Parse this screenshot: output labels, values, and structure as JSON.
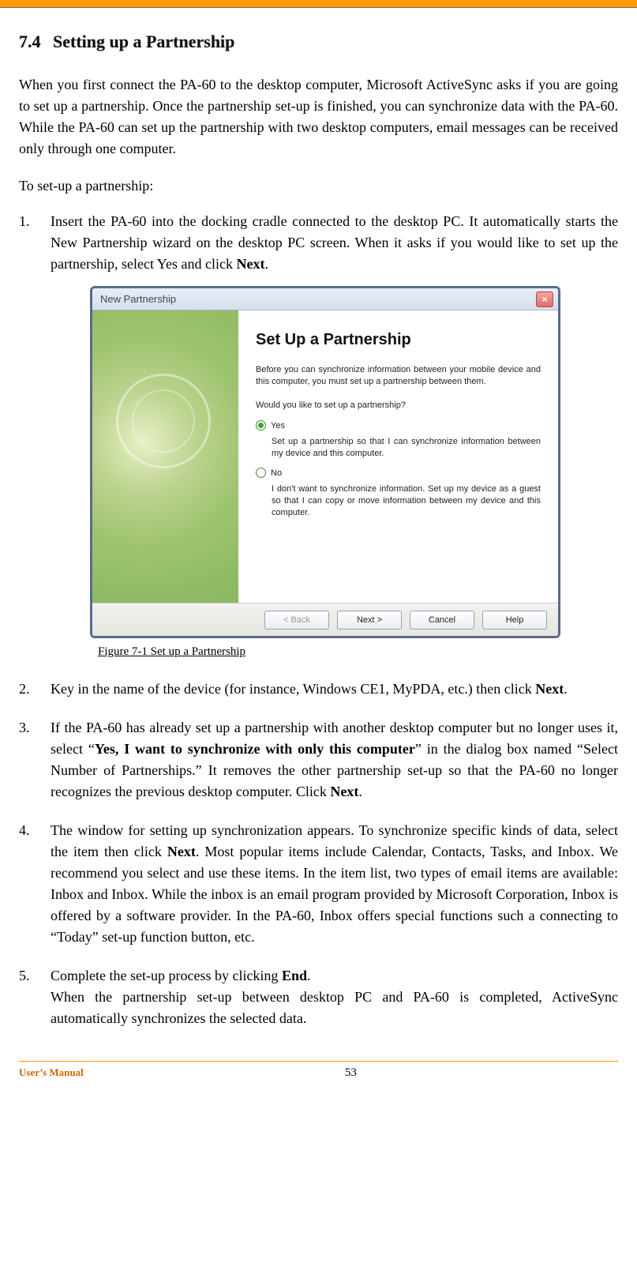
{
  "section": {
    "number": "7.4",
    "title": "Setting up a Partnership"
  },
  "intro": "When you first connect the PA-60 to the desktop computer, Microsoft ActiveSync asks if you are going to set up a partnership. Once the partnership set-up is finished, you can synchronize data with the PA-60. While the PA-60 can set up the partnership with two desktop computers, email messages can be received only through one computer.",
  "lead": "To set-up a partnership:",
  "steps": {
    "s1_a": "Insert the PA-60 into the docking cradle connected to the desktop PC. It automatically starts the New Partnership wizard on the desktop PC screen. When it asks if you would like to set up the partnership, select Yes and click ",
    "s1_bold": "Next",
    "s1_b": ".",
    "s2_a": "Key in the name of the device (for instance, Windows CE1, MyPDA, etc.) then click ",
    "s2_bold": "Next",
    "s2_b": ".",
    "s3_a": "If the PA-60 has already set up a partnership with another desktop computer but no longer uses it, select “",
    "s3_bold1": "Yes, I want to synchronize with only this computer",
    "s3_b": "” in the dialog box named “Select Number of Partnerships.” It removes the other partnership set-up so that the PA-60 no longer recognizes the previous desktop computer. Click ",
    "s3_bold2": "Next",
    "s3_c": ".",
    "s4_a": "The window for setting up synchronization appears. To synchronize specific kinds of data, select the item then click ",
    "s4_bold": "Next",
    "s4_b": ". Most popular items include Calendar, Contacts, Tasks, and Inbox. We recommend you select and use these items. In the item list, two types of email items are available: Inbox and Inbox. While the inbox is an email program provided by Microsoft Corporation, Inbox is offered by a software provider. In the PA-60, Inbox offers special functions such a connecting to “Today” set-up function button, etc.",
    "s5_a": "Complete the set-up process by clicking ",
    "s5_bold": "End",
    "s5_b": ".",
    "s5_c": "When the partnership set-up between desktop PC and PA-60 is completed, ActiveSync automatically synchronizes the selected data."
  },
  "dialog": {
    "window_title": "New Partnership",
    "heading": "Set Up a Partnership",
    "desc": "Before you can synchronize information between your mobile device and this computer, you must set up a partnership between them.",
    "question": "Would you like to set up a partnership?",
    "yes_label": "Yes",
    "yes_sub": "Set up a partnership so that I can synchronize information between my device and this computer.",
    "no_label": "No",
    "no_sub": "I don't want to synchronize information. Set up my device as a guest so that I can copy or move information between my device and this computer.",
    "btn_back": "< Back",
    "btn_next": "Next >",
    "btn_cancel": "Cancel",
    "btn_help": "Help"
  },
  "figure_caption": "Figure 7-1 Set up a Partnership",
  "footer": {
    "left": "User’s Manual",
    "page": "53"
  }
}
